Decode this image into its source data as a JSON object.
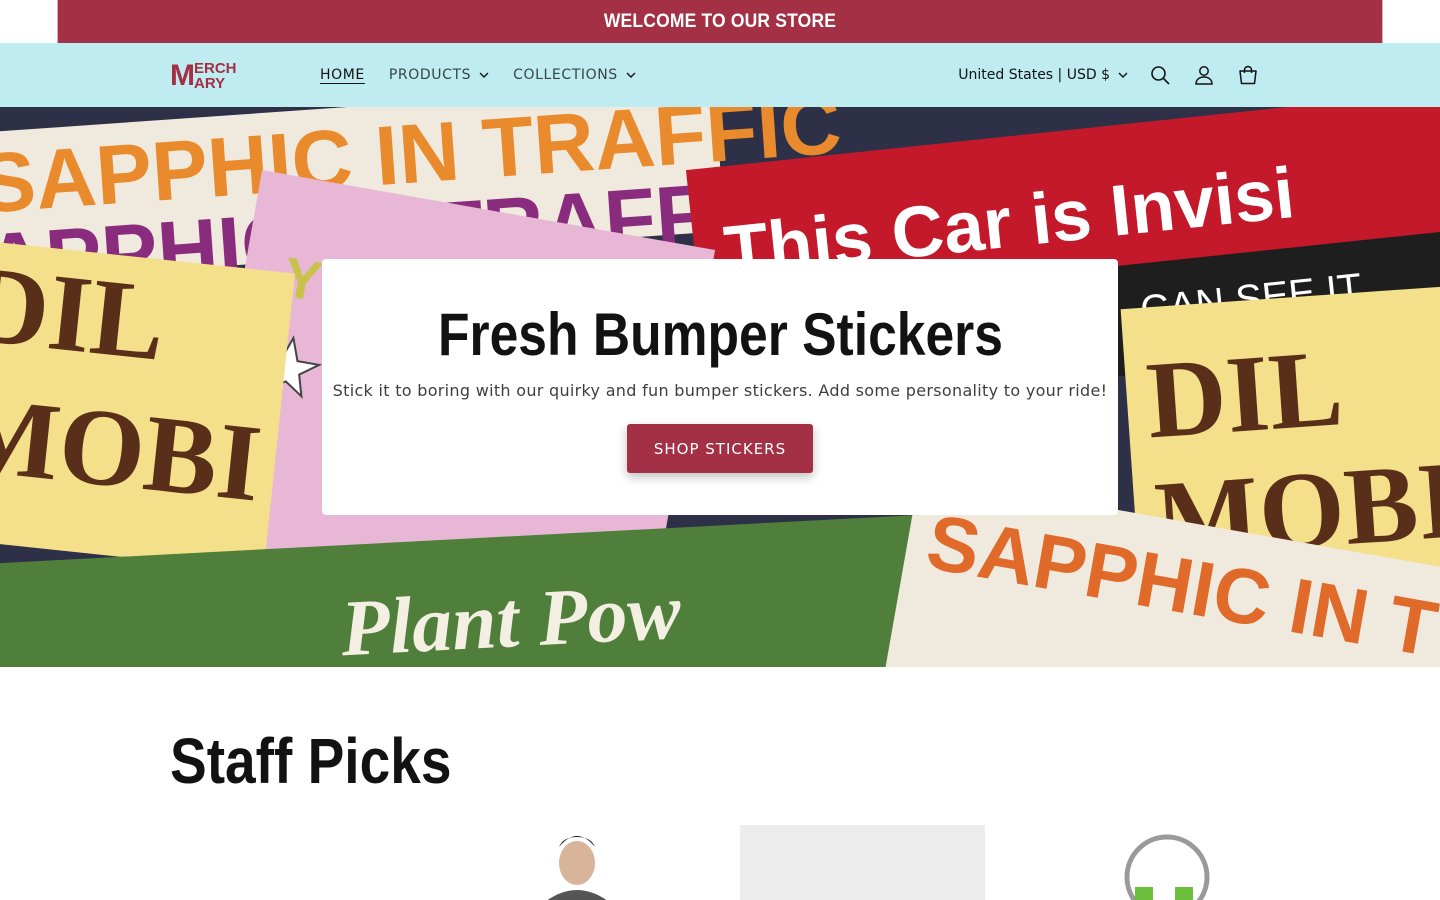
{
  "announcement": {
    "text": "WELCOME TO OUR STORE"
  },
  "header": {
    "logo_text": "MERCH MARY",
    "nav": [
      {
        "label": "HOME",
        "active": true,
        "has_dropdown": false
      },
      {
        "label": "PRODUCTS",
        "active": false,
        "has_dropdown": true
      },
      {
        "label": "COLLECTIONS",
        "active": false,
        "has_dropdown": true
      }
    ],
    "country_label": "United States | USD $",
    "icons": [
      "search-icon",
      "account-icon",
      "cart-icon"
    ]
  },
  "hero": {
    "title": "Fresh Bumper Stickers",
    "subtitle": "Stick it to boring with our quirky and fun bumper stickers. Add some personality to your ride!",
    "button_label": "SHOP STICKERS",
    "sticker_texts": [
      "SAPPHIC IN TRAFFIC",
      "This Car is Invisi",
      "CAN SEE IT",
      "YO",
      "DIL",
      "MOBI",
      "Plant Pow",
      "SAPPHIC IN T"
    ]
  },
  "staff_picks": {
    "title": "Staff Picks"
  },
  "colors": {
    "brand": "#a33045",
    "header_bg": "#bfecf1"
  }
}
